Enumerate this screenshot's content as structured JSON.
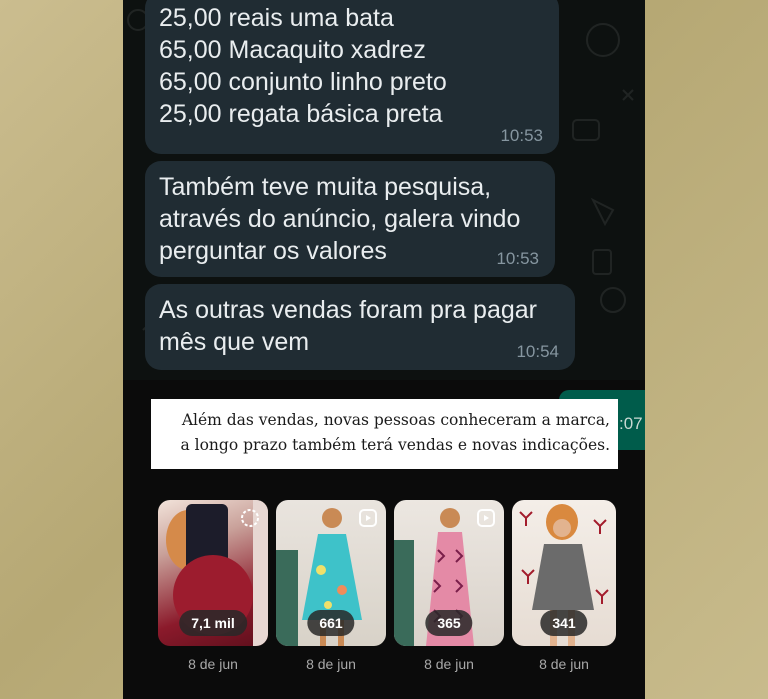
{
  "messages": [
    {
      "lines": [
        "25,00 reais uma bata",
        "65,00 Macaquito xadrez",
        "65,00 conjunto linho preto",
        "25,00 regata básica preta"
      ],
      "time": "10:53"
    },
    {
      "lines": [
        "Também teve muita pesquisa,",
        "através do anúncio, galera vindo",
        "perguntar os valores"
      ],
      "time": "10:53"
    },
    {
      "lines": [
        "As outras vendas foram pra pagar",
        "mês que vem"
      ],
      "time": "10:54"
    }
  ],
  "sent_message": {
    "time_partial": ":07"
  },
  "caption": {
    "line1": "Além das vendas, novas pessoas conheceram a marca,",
    "line2": "a longo prazo também terá vendas e novas indicações."
  },
  "reels": [
    {
      "views": "7,1 mil",
      "date": "8 de jun",
      "icon": "loading-icon",
      "color": "#8b1a2b"
    },
    {
      "views": "661",
      "date": "8 de jun",
      "icon": "reels-icon",
      "color": "#3ec2c9"
    },
    {
      "views": "365",
      "date": "8 de jun",
      "icon": "reels-icon",
      "color": "#e48aa6"
    },
    {
      "views": "341",
      "date": "8 de jun",
      "icon": "none",
      "color": "#6b6b6b"
    }
  ],
  "colors": {
    "incoming_bubble": "#202c33",
    "outgoing_bubble": "#005c4b",
    "caption_bg": "#ffffff",
    "background": "#b6a874"
  }
}
